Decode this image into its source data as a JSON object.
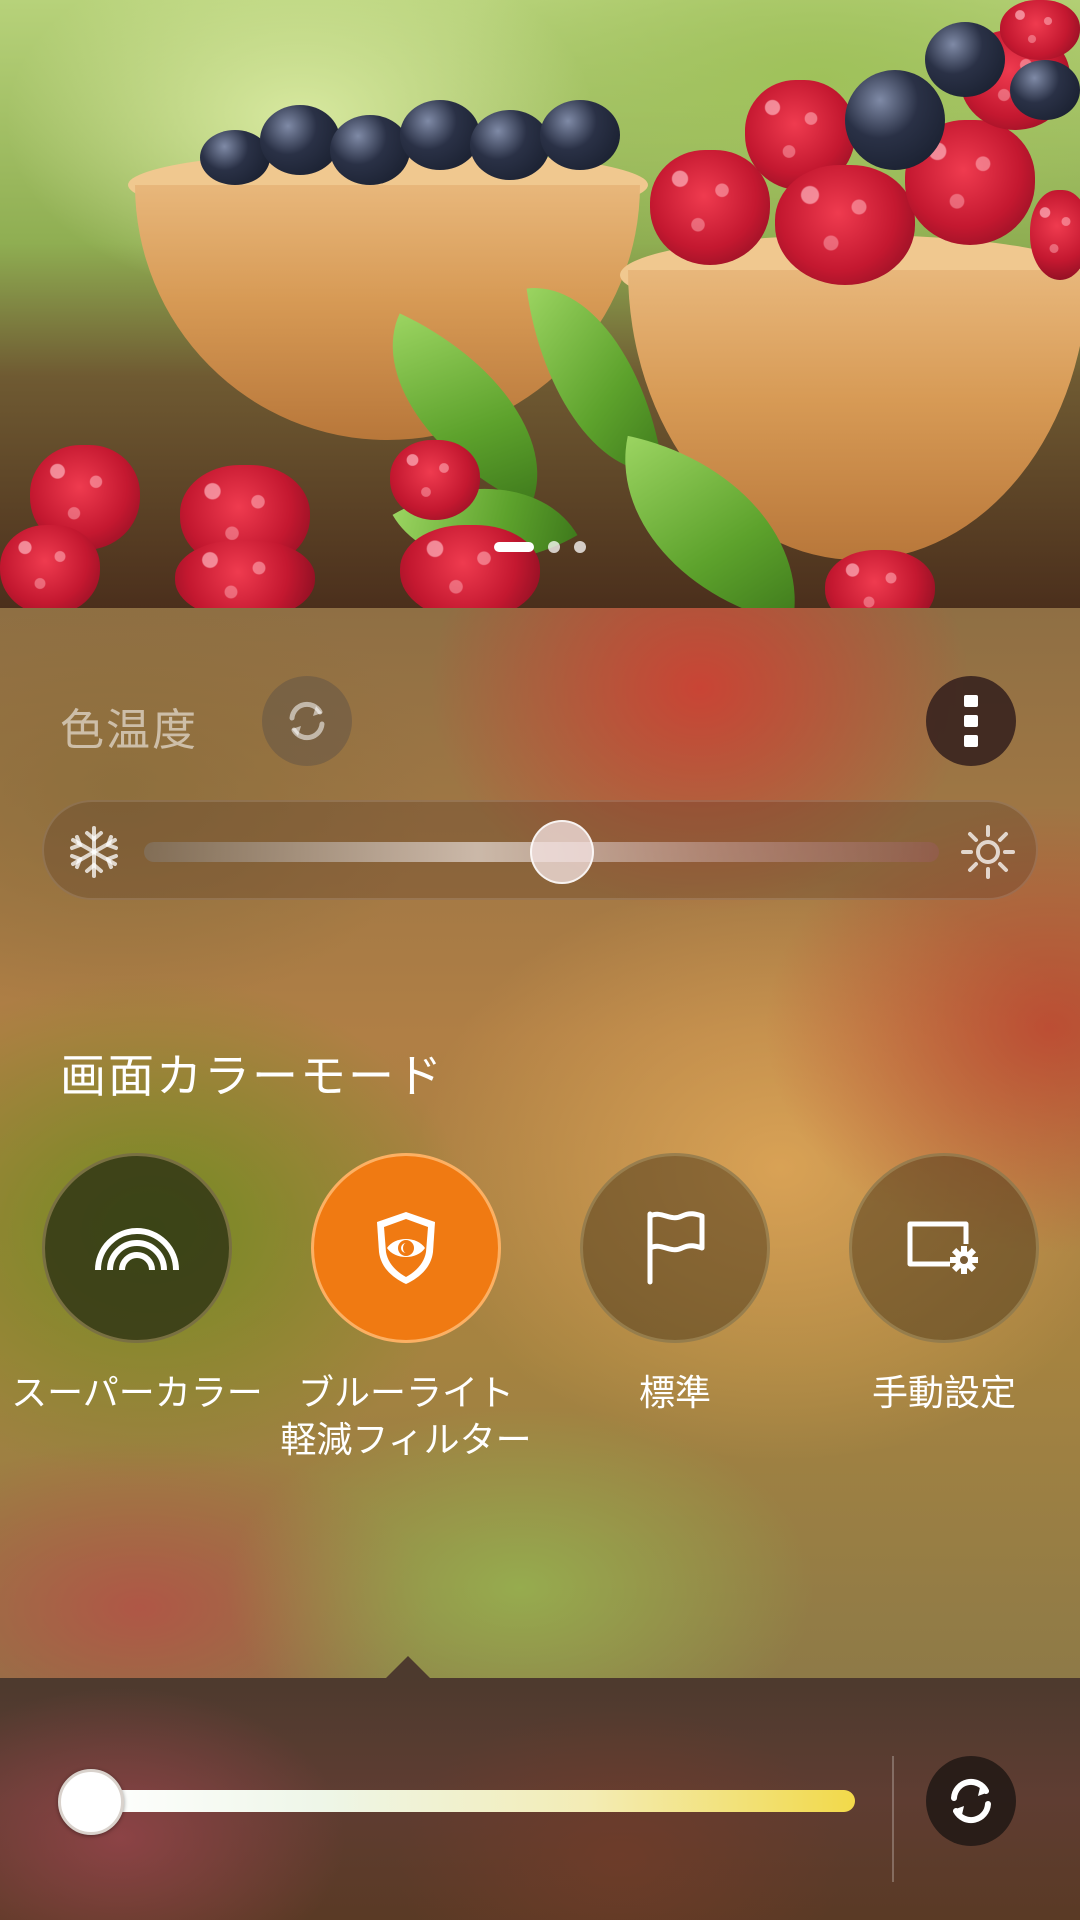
{
  "preview": {
    "page_count": 3,
    "active_page": 1
  },
  "color_temperature": {
    "label": "色温度",
    "level": 0.5,
    "cold_icon": "snowflake-icon",
    "warm_icon": "sun-icon",
    "reset_icon": "refresh-icon",
    "menu_icon": "more-vertical-icon"
  },
  "screen_color_mode": {
    "title": "画面カラーモード",
    "modes": [
      {
        "label": "スーパーカラー",
        "icon": "rainbow-icon",
        "selected": false
      },
      {
        "label": "ブルーライト\n軽減フィルター",
        "icon": "eye-shield-icon",
        "selected": true
      },
      {
        "label": "標準",
        "icon": "flag-icon",
        "selected": false
      },
      {
        "label": "手動設定",
        "icon": "screen-settings-icon",
        "selected": false
      }
    ]
  },
  "blue_light_filter": {
    "level": 0.0,
    "reset_icon": "refresh-icon"
  },
  "colors": {
    "accent": "#f07a12",
    "filter_gradient_end": "#f2d94a"
  }
}
